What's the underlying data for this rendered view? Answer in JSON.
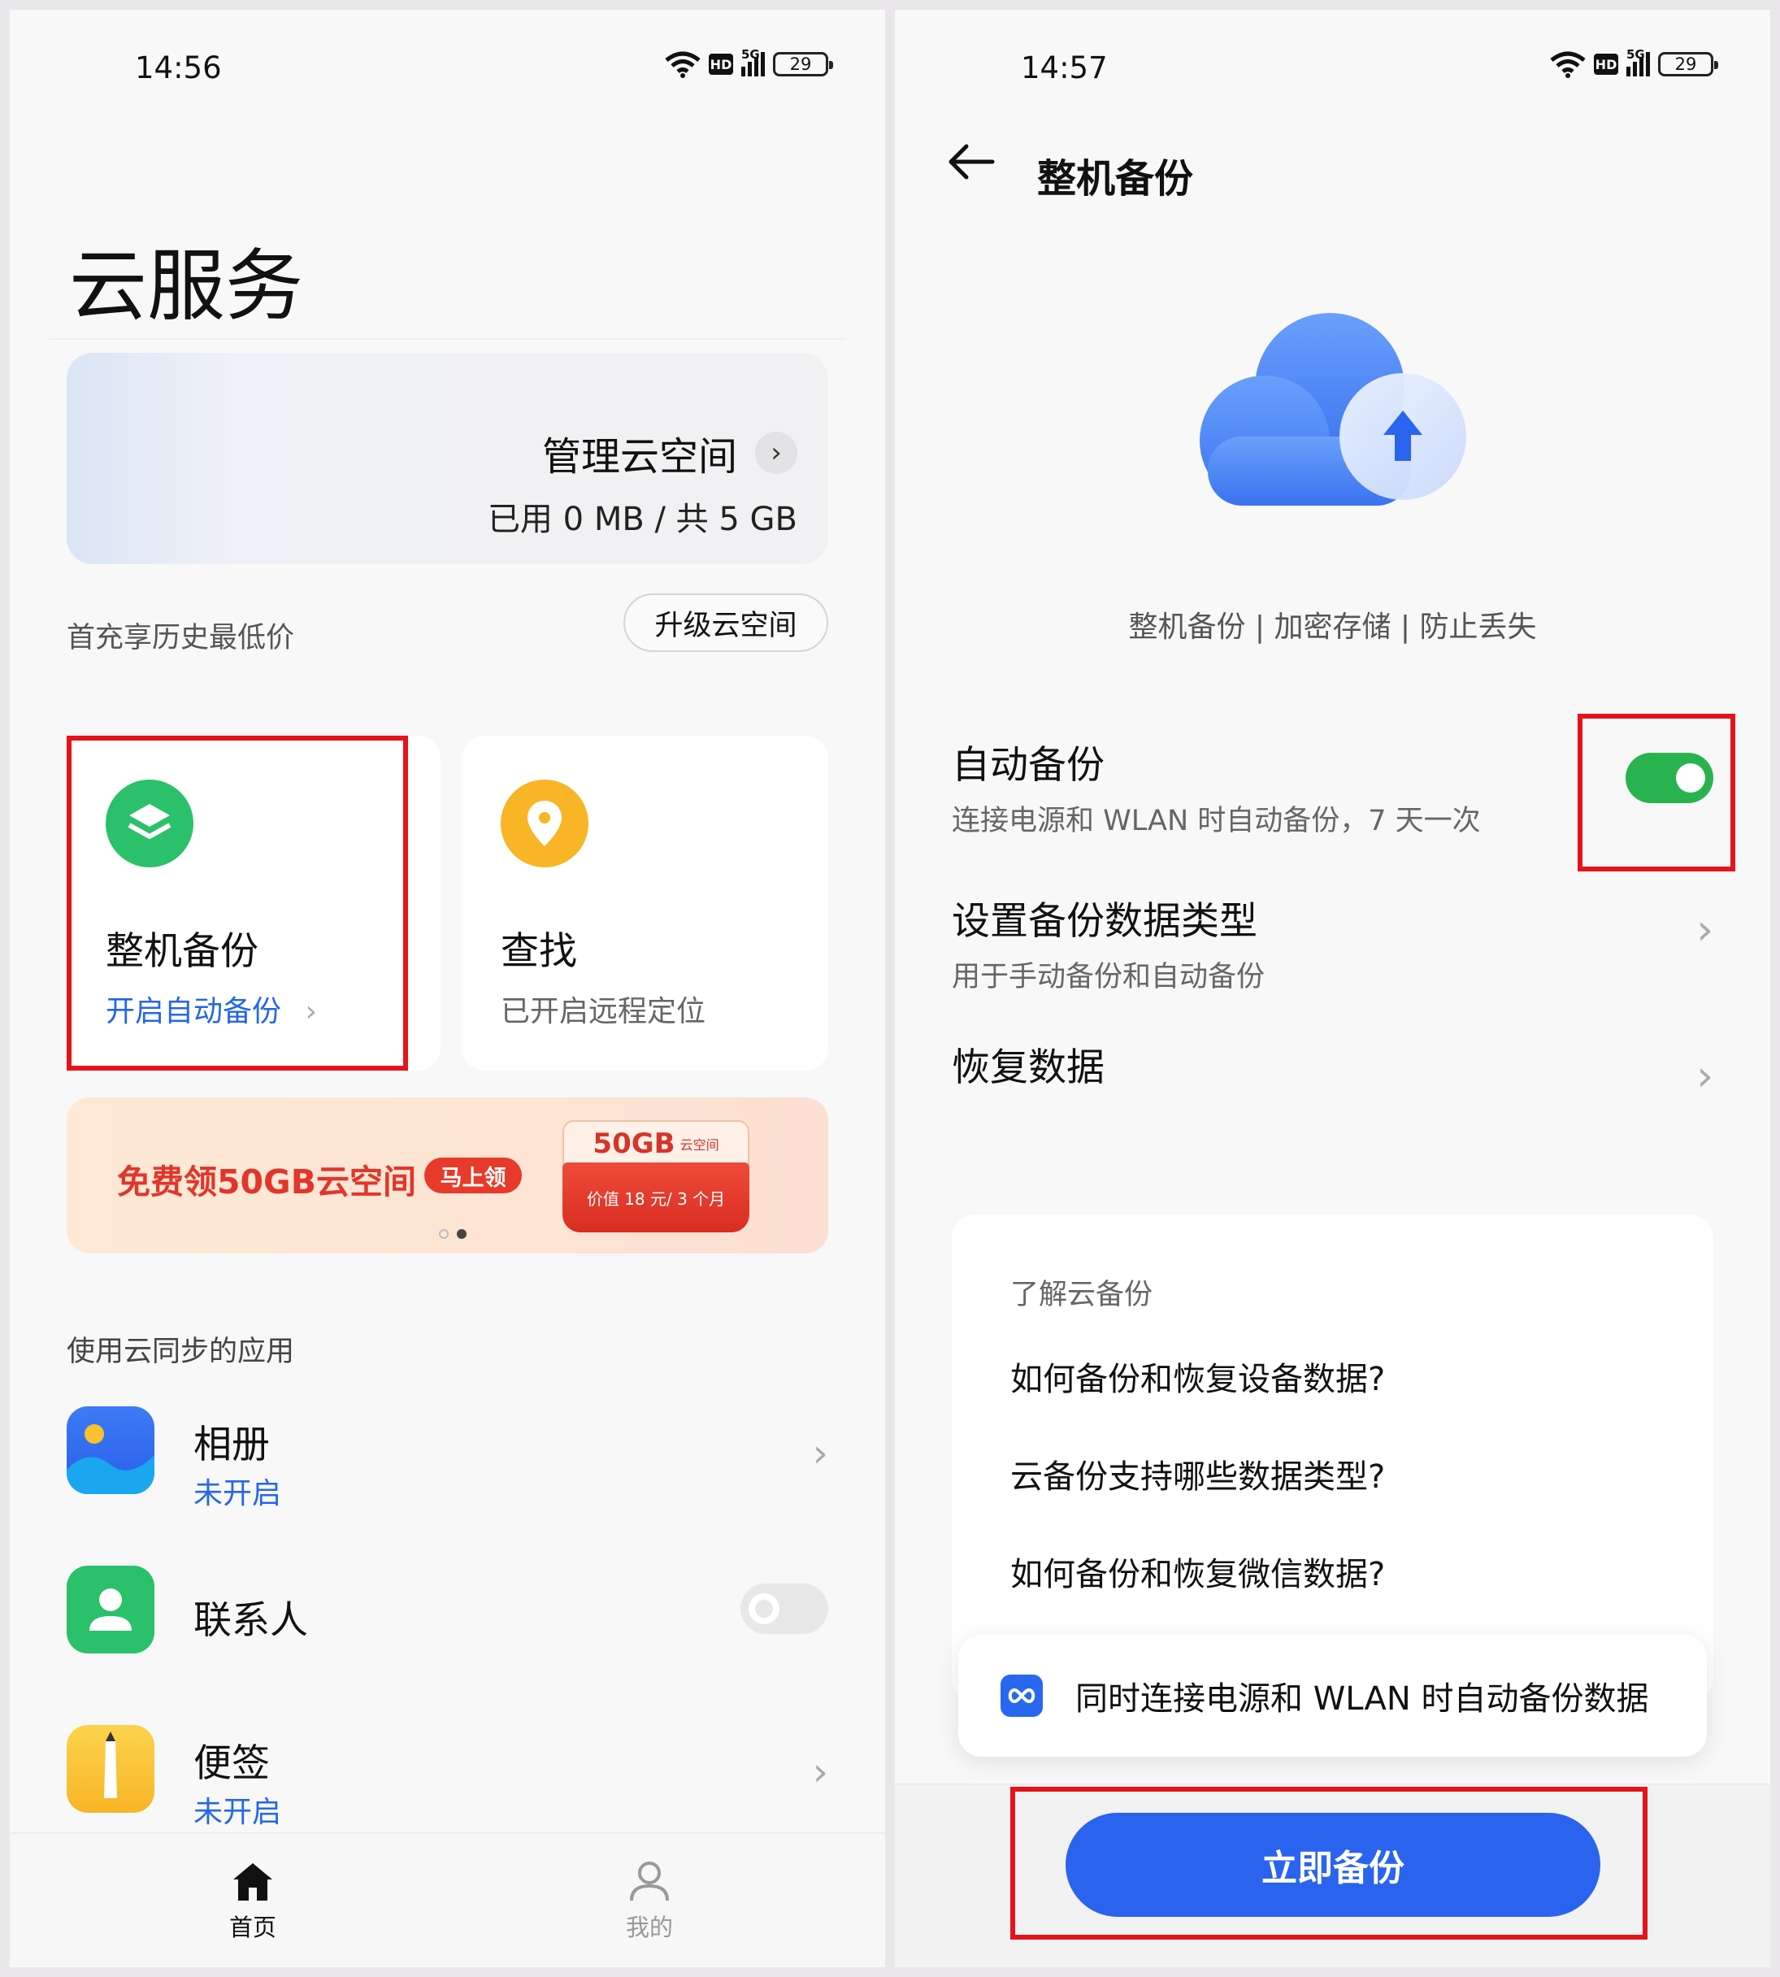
{
  "left": {
    "status": {
      "time": "14:56",
      "network": "5G",
      "hd": "HD",
      "battery": "29"
    },
    "title": "云服务",
    "storage": {
      "manage_label": "管理云空间",
      "usage": "已用 0 MB / 共 5 GB"
    },
    "promo": {
      "text": "首充享历史最低价",
      "upgrade_button": "升级云空间"
    },
    "features": [
      {
        "title": "整机备份",
        "subtitle": "开启自动备份",
        "icon": "layers-icon",
        "color": "#2bc06a",
        "subtitle_color": "#2467e8"
      },
      {
        "title": "查找",
        "subtitle": "已开启远程定位",
        "icon": "location-pin-icon",
        "color": "#f8b526",
        "subtitle_color": "#666666"
      }
    ],
    "banner": {
      "text": "免费领50GB云空间",
      "pill": "马上领",
      "gift_amount": "50GB",
      "gift_unit": "云空间",
      "gift_price": "价值 18 元/ 3 个月",
      "page_count": 2,
      "active_page": 1
    },
    "section_label": "使用云同步的应用",
    "apps": [
      {
        "name": "相册",
        "status": "未开启",
        "icon": "gallery-icon",
        "control": "chevron"
      },
      {
        "name": "联系人",
        "status": "",
        "icon": "contacts-icon",
        "control": "toggle",
        "toggle_on": false
      },
      {
        "name": "便签",
        "status": "未开启",
        "icon": "notes-icon",
        "control": "chevron"
      }
    ],
    "nav": [
      {
        "label": "首页",
        "icon": "home-icon",
        "active": true
      },
      {
        "label": "我的",
        "icon": "profile-icon",
        "active": false
      }
    ]
  },
  "right": {
    "status": {
      "time": "14:57",
      "network": "5G",
      "hd": "HD",
      "battery": "29"
    },
    "page_title": "整机备份",
    "tagline": "整机备份 | 加密存储 | 防止丢失",
    "auto_backup": {
      "title": "自动备份",
      "subtitle": "连接电源和 WLAN 时自动备份，7 天一次",
      "toggle_on": true
    },
    "settings": [
      {
        "title": "设置备份数据类型",
        "subtitle": "用于手动备份和自动备份"
      },
      {
        "title": "恢复数据",
        "subtitle": ""
      }
    ],
    "faq": {
      "heading": "了解云备份",
      "items": [
        "如何备份和恢复设备数据?",
        "云备份支持哪些数据类型?",
        "如何备份和恢复微信数据?"
      ]
    },
    "tip": "同时连接电源和 WLAN 时自动备份数据",
    "backup_button": "立即备份"
  },
  "colors": {
    "accent_blue": "#2a63ee",
    "link_blue": "#2467e8",
    "toggle_green": "#28b34f",
    "highlight_red": "#e5131a"
  }
}
